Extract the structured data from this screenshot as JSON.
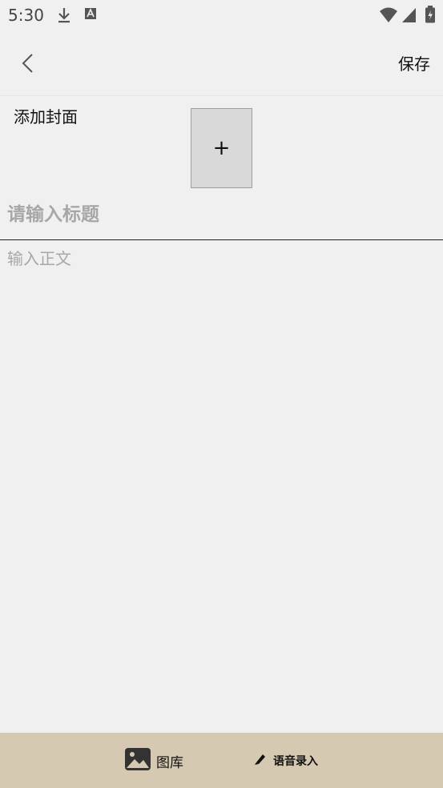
{
  "status_bar": {
    "time": "5:30",
    "icons": [
      "download-icon",
      "a-notification-icon",
      "wifi-icon",
      "signal-icon",
      "battery-icon"
    ]
  },
  "app_bar": {
    "back_icon": "chevron-left-icon",
    "save_label": "保存"
  },
  "cover": {
    "label": "添加封面",
    "add_glyph": "+"
  },
  "editor": {
    "title_placeholder": "请输入标题",
    "title_value": "",
    "body_placeholder": "输入正文",
    "body_value": ""
  },
  "toolbar": {
    "gallery_label": "图库",
    "gallery_icon": "image-icon",
    "voice_label": "语音录入",
    "voice_icon": "pen-icon"
  },
  "colors": {
    "background": "#f0f0f0",
    "toolbar_bg": "#d5cab1",
    "placeholder": "#a7a7a7",
    "cover_box": "#d9d9d9"
  }
}
